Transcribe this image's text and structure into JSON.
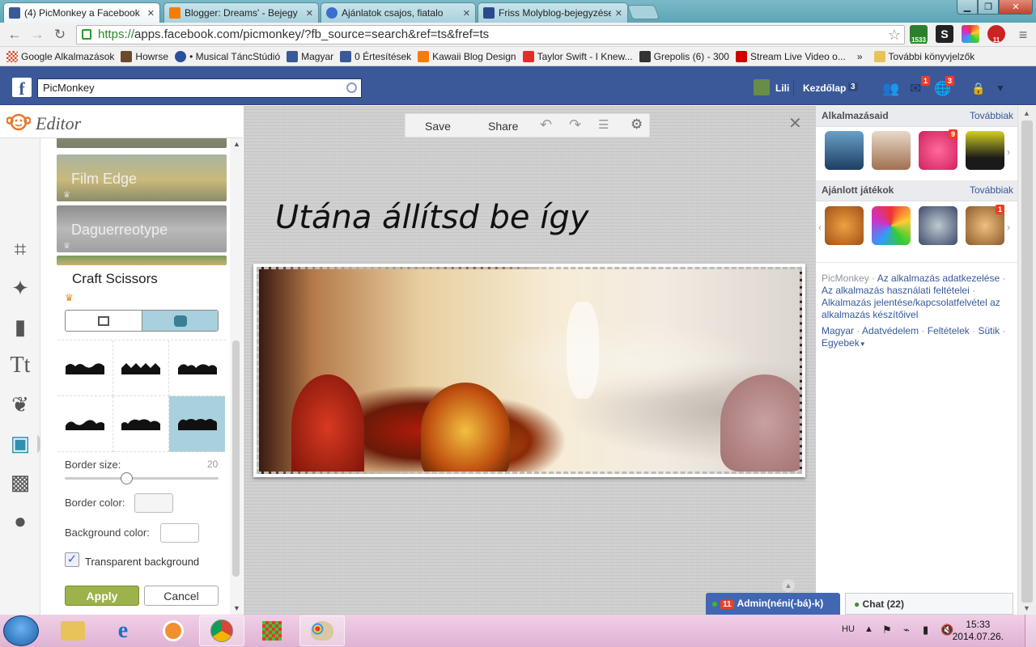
{
  "browser": {
    "tabs": [
      {
        "title": "(4) PicMonkey a Facebook",
        "color": "#3b5998",
        "active": true
      },
      {
        "title": "Blogger: Dreams' - Bejegy",
        "color": "#f57d00",
        "active": false
      },
      {
        "title": "Ajánlatok csajos, fiatalo",
        "color": "#3a6fd0",
        "active": false
      },
      {
        "title": "Friss Molyblog-bejegyzése",
        "color": "#2b4a8c",
        "active": false
      }
    ],
    "url_https": "https://",
    "url_rest": "apps.facebook.com/picmonkey/?fb_source=search&ref=ts&fref=ts",
    "ext_badges": {
      "ext1": "1533",
      "ext2": "11"
    }
  },
  "bookmarks": [
    {
      "label": "Google Alkalmazások",
      "icon": "apps-icon",
      "color": "#d04a2c"
    },
    {
      "label": "Howrse",
      "icon": "horse-icon",
      "color": "#6b4a2b"
    },
    {
      "label": "• Musical TáncStúdió",
      "icon": "dancer-icon",
      "color": "#2a4f9c"
    },
    {
      "label": "Magyar",
      "icon": "facebook-icon",
      "color": "#3b5998"
    },
    {
      "label": "0 Értesítések",
      "icon": "facebook-icon",
      "color": "#3b5998"
    },
    {
      "label": "Kawaii Blog Design",
      "icon": "blogger-icon",
      "color": "#f57d00"
    },
    {
      "label": "Taylor Swift - I Knew...",
      "icon": "youtube-icon",
      "color": "#e52d27"
    },
    {
      "label": "Grepolis (6) - 300",
      "icon": "grepolis-icon",
      "color": "#333"
    },
    {
      "label": "Stream Live Video o...",
      "icon": "stream-icon",
      "color": "#cc0000"
    }
  ],
  "bookmarks_more": "»",
  "bookmarks_folder": "További könyvjelzők",
  "facebook": {
    "search_value": "PicMonkey",
    "user_name": "Lili",
    "home_label": "Kezdőlap",
    "home_count": "3",
    "messages_badge": "1",
    "notifications_badge": "3"
  },
  "editor": {
    "title": "Editor",
    "effects": [
      {
        "label": "Film Edge"
      },
      {
        "label": "Daguerreotype"
      }
    ],
    "section_title": "Craft Scissors",
    "border_size_label": "Border size:",
    "border_size_value": "20",
    "border_size_fraction": 0.4,
    "border_color_label": "Border color:",
    "background_color_label": "Background color:",
    "transparent_label": "Transparent background",
    "transparent_checked": true,
    "apply_label": "Apply",
    "cancel_label": "Cancel",
    "colors": {
      "apply": "#9cb24a",
      "selected_shape": "#a8d0dd",
      "crown": "#e88b1c"
    }
  },
  "canvas": {
    "save_label": "Save",
    "share_label": "Share",
    "headline": "Utána állítsd be így"
  },
  "right_column": {
    "apps_title": "Alkalmazásaid",
    "apps_more": "Továbbiak",
    "apps_badge": "9",
    "games_title": "Ajánlott játékok",
    "games_more": "Továbbiak",
    "games_badge": "1",
    "links": {
      "picmonkey": "PicMonkey",
      "l1": "Az alkalmazás adatkezelése",
      "l2": "Az alkalmazás használati feltételei",
      "l3": "Alkalmazás jelentése/kapcsolatfelvétel az alkalmazás készítőivel",
      "l4": "Magyar",
      "l5": "Adatvédelem",
      "l6": "Feltételek",
      "l7": "Sütik",
      "l8": "Egyebek"
    },
    "sep": " · "
  },
  "chat": {
    "admin_count": "11",
    "admin_label": "Admin(néni(-bá)-k)",
    "chat_label": "Chat (22)"
  },
  "taskbar": {
    "lang": "HU",
    "time": "15:33",
    "date": "2014.07.26."
  }
}
